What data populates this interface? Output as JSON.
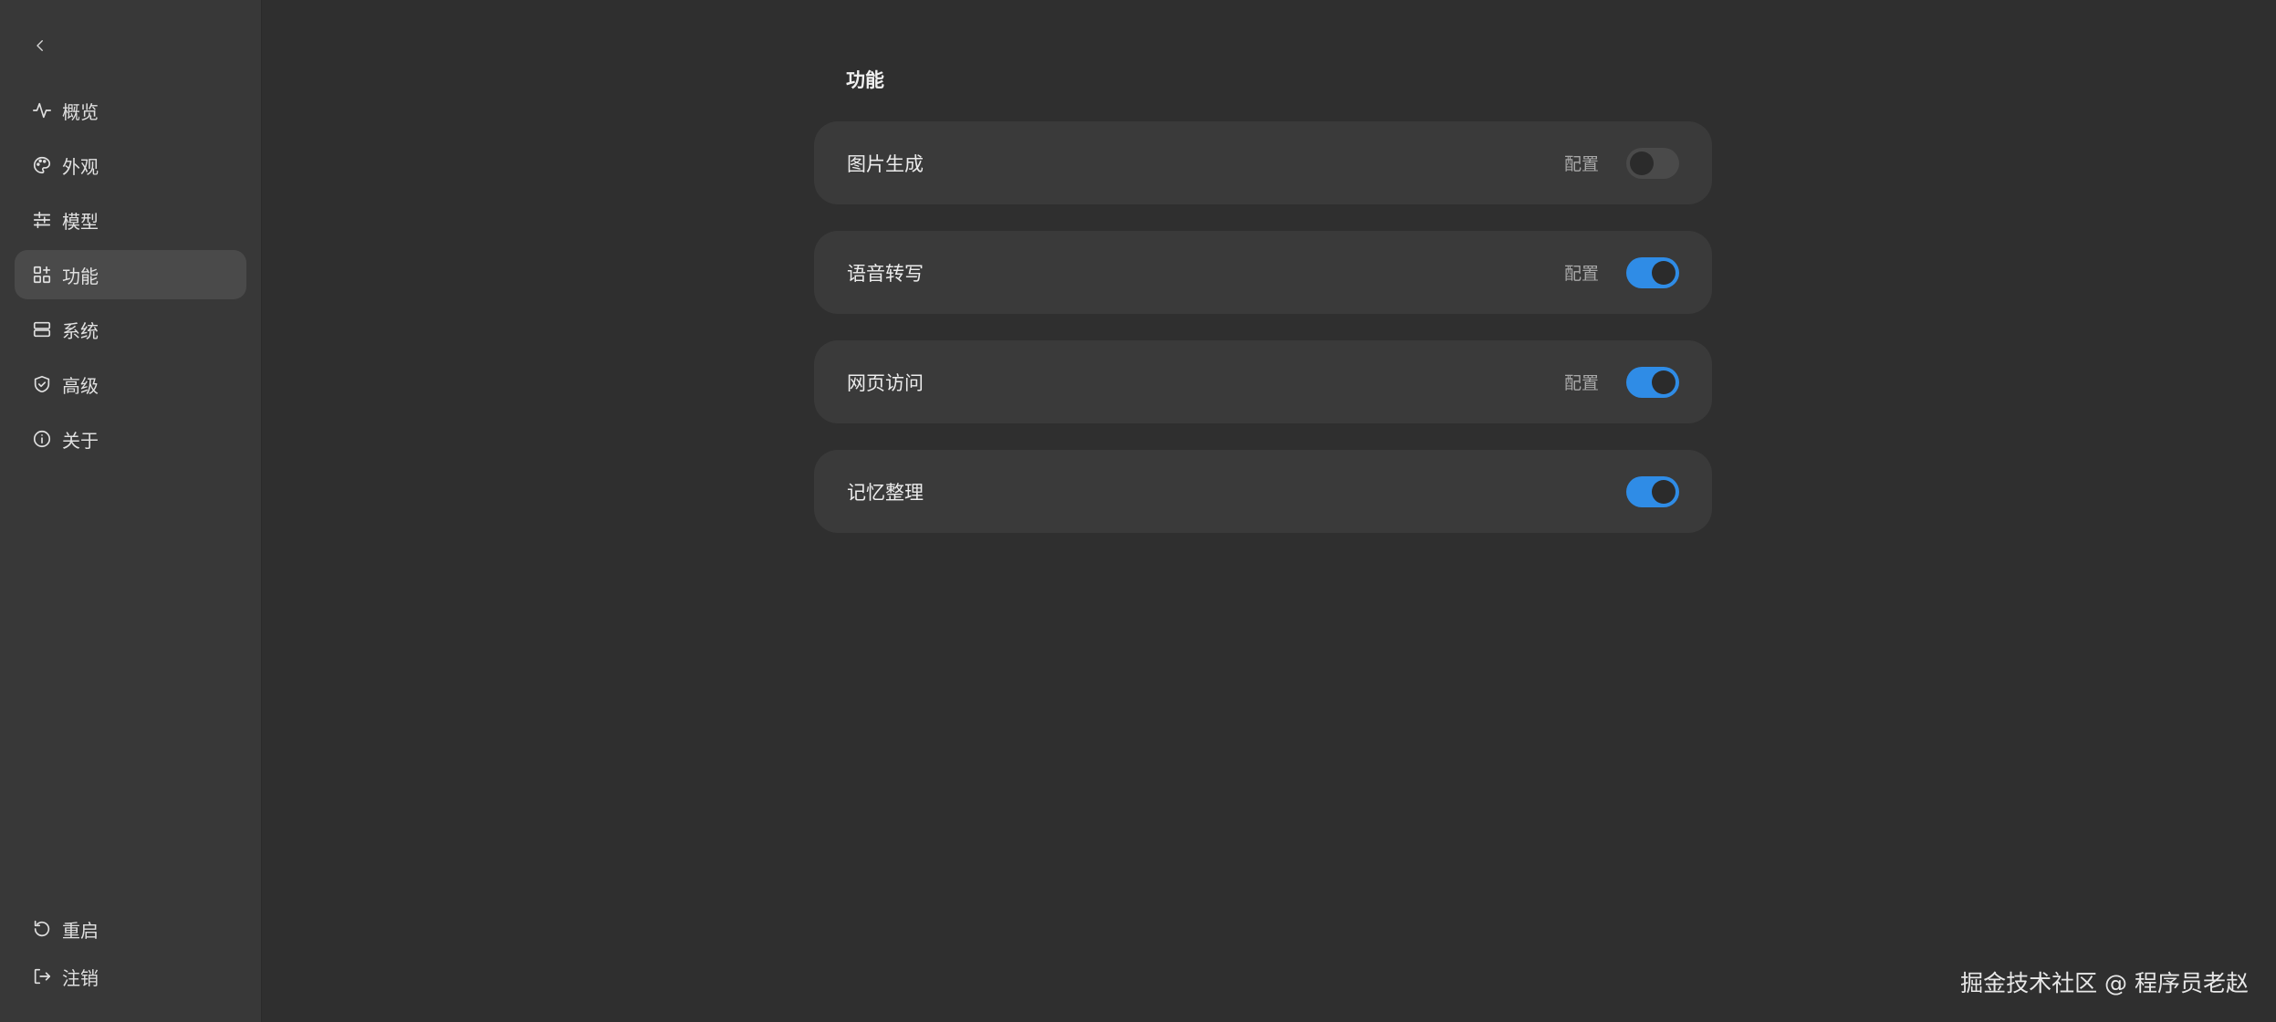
{
  "sidebar": {
    "back_icon": "chevron-left-icon",
    "items": [
      {
        "label": "概览",
        "icon": "activity-icon",
        "active": false
      },
      {
        "label": "外观",
        "icon": "palette-icon",
        "active": false
      },
      {
        "label": "模型",
        "icon": "sliders-icon",
        "active": false
      },
      {
        "label": "功能",
        "icon": "grid-plus-icon",
        "active": true
      },
      {
        "label": "系统",
        "icon": "server-icon",
        "active": false
      },
      {
        "label": "高级",
        "icon": "shield-check-icon",
        "active": false
      },
      {
        "label": "关于",
        "icon": "info-icon",
        "active": false
      }
    ],
    "bottom": [
      {
        "label": "重启",
        "icon": "restart-icon"
      },
      {
        "label": "注销",
        "icon": "logout-icon"
      }
    ]
  },
  "main": {
    "section_title": "功能",
    "features": [
      {
        "label": "图片生成",
        "config_label": "配置",
        "enabled": false
      },
      {
        "label": "语音转写",
        "config_label": "配置",
        "enabled": true
      },
      {
        "label": "网页访问",
        "config_label": "配置",
        "enabled": true
      },
      {
        "label": "记忆整理",
        "config_label": "",
        "enabled": true
      }
    ]
  },
  "watermark": "掘金技术社区 @ 程序员老赵",
  "colors": {
    "background": "#2f2f2f",
    "sidebar": "#383838",
    "card": "#3a3a3a",
    "active_nav": "#4a4a4a",
    "toggle_on": "#2f8ce6",
    "toggle_off": "#4a4a4a"
  }
}
